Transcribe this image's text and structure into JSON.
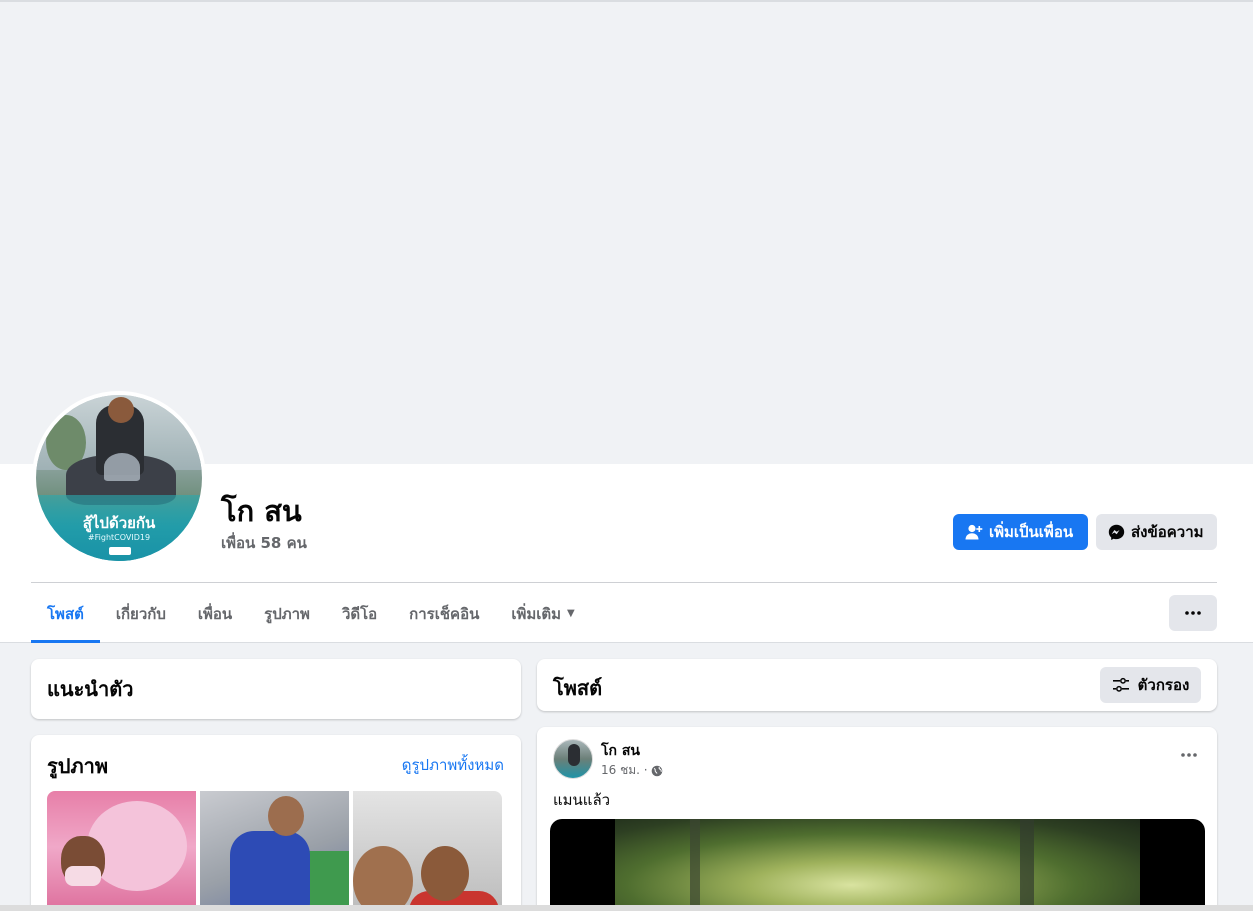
{
  "profile": {
    "name": "โก สน",
    "friends": "เพื่อน 58 คน",
    "avatar_frame_text": "สู้ไปด้วยกัน",
    "avatar_frame_hashtag": "#FightCOVID19"
  },
  "actions": {
    "add_friend": "เพิ่มเป็นเพื่อน",
    "message": "ส่งข้อความ",
    "add_friend_icon": "add-friend-icon",
    "message_icon": "messenger-icon"
  },
  "tabs": [
    {
      "label": "โพสต์",
      "active": true
    },
    {
      "label": "เกี่ยวกับ"
    },
    {
      "label": "เพื่อน"
    },
    {
      "label": "รูปภาพ"
    },
    {
      "label": "วิดีโอ"
    },
    {
      "label": "การเช็คอิน"
    },
    {
      "label": "เพิ่มเติม"
    }
  ],
  "intro": {
    "title": "แนะนำตัว"
  },
  "photos": {
    "title": "รูปภาพ",
    "see_all": "ดูรูปภาพทั้งหมด"
  },
  "posts": {
    "title": "โพสต์",
    "filter": "ตัวกรอง"
  },
  "post": {
    "author": "โก สน",
    "time": "16 ชม. ·",
    "privacy_icon": "globe-icon",
    "text": "แมนแล้ว"
  },
  "colors": {
    "accent": "#1877f2",
    "background": "#f0f2f5",
    "secondary_button": "#e4e6eb"
  }
}
